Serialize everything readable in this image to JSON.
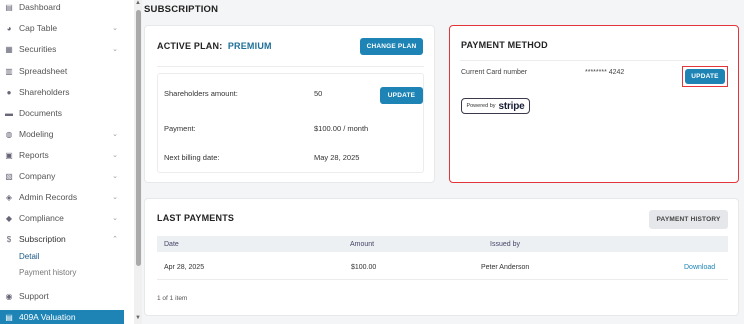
{
  "sidebar": {
    "items": [
      {
        "label": "Dashboard",
        "icon": "dashboard-icon",
        "glyph": "▤",
        "chevron": ""
      },
      {
        "label": "Cap Table",
        "icon": "pie-chart-icon",
        "glyph": "◕",
        "chevron": "⌄"
      },
      {
        "label": "Securities",
        "icon": "document-icon",
        "glyph": "▦",
        "chevron": "⌄"
      },
      {
        "label": "Spreadsheet",
        "icon": "spreadsheet-icon",
        "glyph": "▥",
        "chevron": ""
      },
      {
        "label": "Shareholders",
        "icon": "person-icon",
        "glyph": "●",
        "chevron": ""
      },
      {
        "label": "Documents",
        "icon": "folder-icon",
        "glyph": "▬",
        "chevron": ""
      },
      {
        "label": "Modeling",
        "icon": "lightbulb-icon",
        "glyph": "◍",
        "chevron": "⌄"
      },
      {
        "label": "Reports",
        "icon": "reports-icon",
        "glyph": "▣",
        "chevron": "⌄"
      },
      {
        "label": "Company",
        "icon": "building-icon",
        "glyph": "▧",
        "chevron": "⌄"
      },
      {
        "label": "Admin Records",
        "icon": "admin-icon",
        "glyph": "◈",
        "chevron": "⌄"
      },
      {
        "label": "Compliance",
        "icon": "shield-icon",
        "glyph": "◆",
        "chevron": "⌄"
      },
      {
        "label": "Subscription",
        "icon": "dollar-icon",
        "glyph": "$",
        "chevron": "⌃"
      }
    ],
    "sub_items": [
      "Detail",
      "Payment history"
    ],
    "support": {
      "label": "Support",
      "icon": "support-icon",
      "glyph": "◉"
    },
    "highlight": {
      "label": "409A Valuation",
      "icon": "valuation-icon",
      "glyph": "▤"
    }
  },
  "page": {
    "title": "SUBSCRIPTION"
  },
  "plan": {
    "title_prefix": "ACTIVE PLAN:",
    "plan_name": "PREMIUM",
    "change_button": "CHANGE PLAN",
    "rows": {
      "shareholders_label": "Shareholders amount:",
      "shareholders_value": "50",
      "update_button": "UPDATE",
      "payment_label": "Payment:",
      "payment_value": "$100.00 / month",
      "billing_label": "Next billing date:",
      "billing_value": "May 28, 2025"
    }
  },
  "payment_method": {
    "title": "PAYMENT METHOD",
    "card_label": "Current Card number",
    "card_value": "******** 4242",
    "update_button": "UPDATE",
    "badge_prefix": "Powered by",
    "badge_brand": "stripe"
  },
  "last_payments": {
    "title": "LAST PAYMENTS",
    "history_button": "PAYMENT HISTORY",
    "columns": [
      "Date",
      "Amount",
      "Issued by"
    ],
    "rows": [
      {
        "date": "Apr 28, 2025",
        "amount": "$100.00",
        "issued_by": "Peter Anderson",
        "action": "Download"
      }
    ],
    "footer": "1 of 1 item"
  },
  "colors": {
    "accent": "#1d84b5",
    "highlight_border": "#e4363a",
    "plan_name": "#1f6f98"
  }
}
